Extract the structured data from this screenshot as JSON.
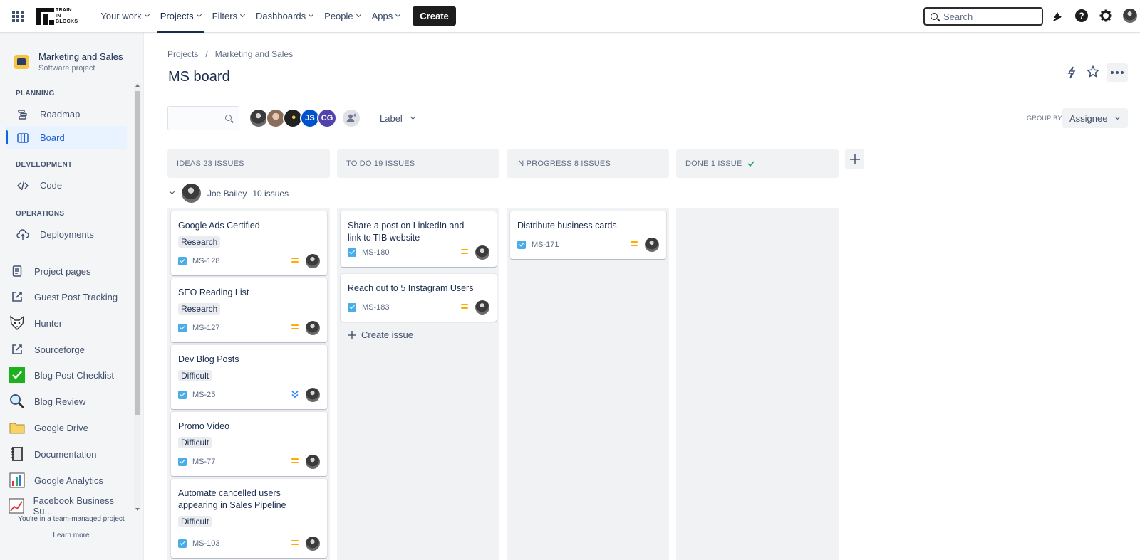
{
  "topnav": {
    "logo_text": [
      "TRAIN",
      "IN",
      "BLOCKS"
    ],
    "items": [
      {
        "label": "Your work",
        "active": false
      },
      {
        "label": "Projects",
        "active": true
      },
      {
        "label": "Filters",
        "active": false
      },
      {
        "label": "Dashboards",
        "active": false
      },
      {
        "label": "People",
        "active": false
      },
      {
        "label": "Apps",
        "active": false
      }
    ],
    "create_label": "Create",
    "search_placeholder": "Search",
    "icons": [
      "notifications-icon",
      "help-icon",
      "settings-icon",
      "profile-avatar"
    ]
  },
  "sidebar": {
    "project_name": "Marketing and Sales",
    "project_type": "Software project",
    "sections": [
      {
        "title": "PLANNING",
        "items": [
          {
            "label": "Roadmap",
            "icon": "roadmap-icon"
          },
          {
            "label": "Board",
            "icon": "board-icon",
            "selected": true
          }
        ]
      },
      {
        "title": "DEVELOPMENT",
        "items": [
          {
            "label": "Code",
            "icon": "code-icon"
          }
        ]
      },
      {
        "title": "OPERATIONS",
        "items": [
          {
            "label": "Deployments",
            "icon": "deployments-icon"
          }
        ]
      }
    ],
    "links": [
      {
        "label": "Project pages",
        "icon": "pages-icon"
      },
      {
        "label": "Guest Post Tracking",
        "icon": "external-link-icon"
      },
      {
        "label": "Hunter",
        "icon": "fox-icon"
      },
      {
        "label": "Sourceforge",
        "icon": "external-link-icon"
      },
      {
        "label": "Blog Post Checklist",
        "icon": "checkmark-icon"
      },
      {
        "label": "Blog Review",
        "icon": "magnifier-icon"
      },
      {
        "label": "Google Drive",
        "icon": "folder-icon"
      },
      {
        "label": "Documentation",
        "icon": "notebook-icon"
      },
      {
        "label": "Google Analytics",
        "icon": "bar-chart-icon"
      },
      {
        "label": "Facebook Business Su...",
        "icon": "line-chart-icon"
      }
    ],
    "footer_text": "You're in a team-managed project",
    "footer_link": "Learn more"
  },
  "main": {
    "breadcrumb": [
      "Projects",
      "/",
      "Marketing and Sales"
    ],
    "title": "MS board",
    "filter_avatars": [
      {
        "initials": "",
        "color": "#555555"
      },
      {
        "initials": "",
        "color": "#8a6d5a"
      },
      {
        "initials": "",
        "color": "#222222"
      },
      {
        "initials": "JS",
        "color": "#0052cc"
      },
      {
        "initials": "CG",
        "color": "#5243aa"
      }
    ],
    "label_filter": "Label",
    "group_by_label": "GROUP BY",
    "group_by_value": "Assignee",
    "columns": [
      {
        "title": "IDEAS 23 ISSUES",
        "done": false
      },
      {
        "title": "TO DO 19 ISSUES",
        "done": false
      },
      {
        "title": "IN PROGRESS 8 ISSUES",
        "done": false
      },
      {
        "title": "DONE 1 ISSUE",
        "done": true
      }
    ],
    "swimlane": {
      "name": "Joe Bailey",
      "count": "10 issues"
    },
    "cards": {
      "ideas": [
        {
          "summary": "Google Ads Certified",
          "label": "Research",
          "key": "MS-128",
          "priority": "medium"
        },
        {
          "summary": "SEO Reading List",
          "label": "Research",
          "key": "MS-127",
          "priority": "medium"
        },
        {
          "summary": "Dev Blog Posts",
          "label": "Difficult",
          "key": "MS-25",
          "priority": "lowest"
        },
        {
          "summary": "Promo Video",
          "label": "Difficult",
          "key": "MS-77",
          "priority": "medium"
        },
        {
          "summary": "Automate cancelled users appearing in Sales Pipeline",
          "label": "Difficult",
          "key": "MS-103",
          "priority": "medium"
        }
      ],
      "todo": [
        {
          "summary": "Share a post on LinkedIn and link to TIB website",
          "label": "",
          "key": "MS-180",
          "priority": "medium"
        },
        {
          "summary": "Reach out to 5 Instagram Users",
          "label": "",
          "key": "MS-183",
          "priority": "medium"
        }
      ],
      "inprogress": [
        {
          "summary": "Distribute business cards",
          "label": "",
          "key": "MS-171",
          "priority": "medium"
        }
      ]
    },
    "create_issue_label": "Create issue",
    "colors": {
      "accent": "#0c66e4",
      "medium_priority": "#ffab00",
      "lowest_priority": "#2684ff",
      "column_bg": "#f1f2f4"
    }
  }
}
